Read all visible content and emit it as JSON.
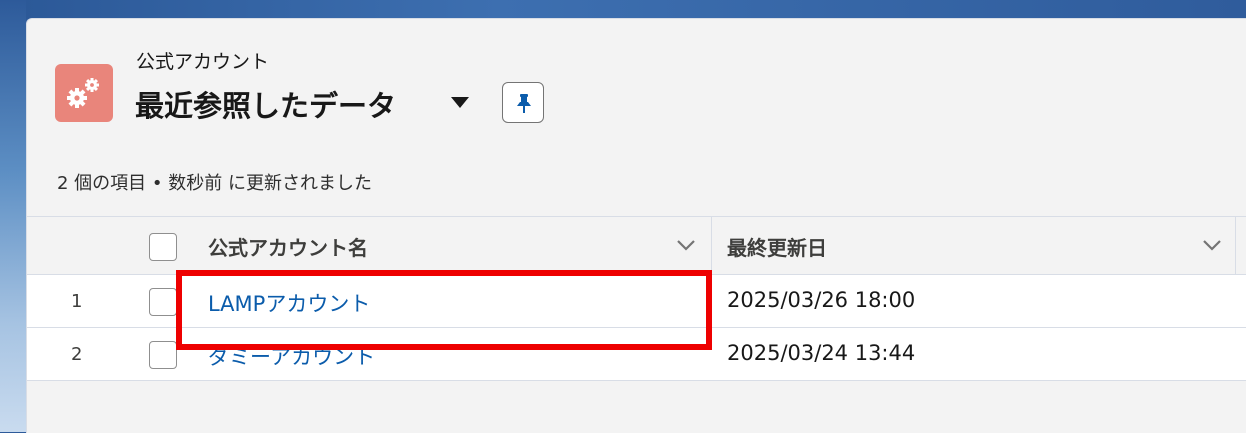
{
  "header": {
    "object_label": "公式アカウント",
    "view_title": "最近参照したデータ",
    "object_icon": "gears-icon",
    "dropdown_icon": "caret-down-icon",
    "pin_icon": "pin-icon",
    "icon_color": "#e9857b"
  },
  "list_info": "2 個の項目 • 数秒前 に更新されました",
  "table": {
    "columns": [
      {
        "label": "公式アカウント名"
      },
      {
        "label": "最終更新日"
      }
    ],
    "rows": [
      {
        "num": "1",
        "name": "LAMPアカウント",
        "date": "2025/03/26 18:00"
      },
      {
        "num": "2",
        "name": "ダミーアカウント",
        "date": "2025/03/24 13:44"
      }
    ]
  },
  "colors": {
    "link": "#0b5cab",
    "highlight": "#ee0000"
  }
}
